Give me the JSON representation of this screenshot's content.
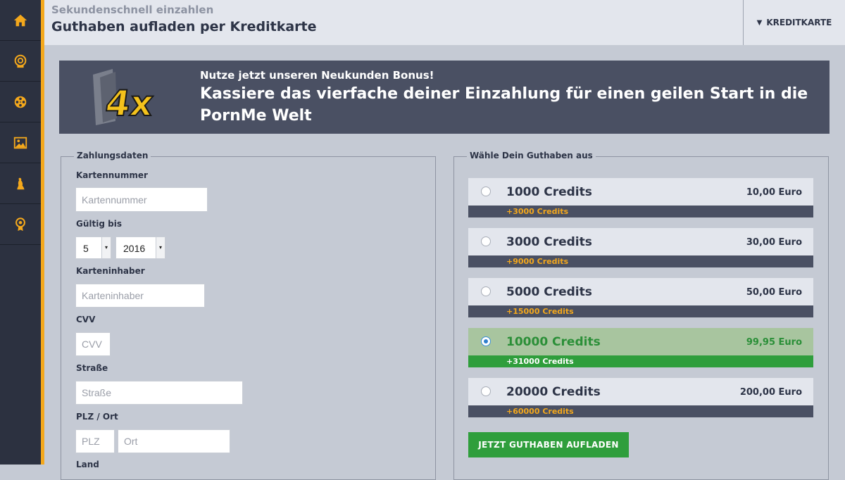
{
  "sidebar": {
    "items": [
      {
        "icon": "home-icon",
        "color": "#f4a81c"
      },
      {
        "icon": "webcam-icon",
        "color": "#f4a81c"
      },
      {
        "icon": "film-reel-icon",
        "color": "#f4a81c"
      },
      {
        "icon": "image-icon",
        "color": "#f4a81c"
      },
      {
        "icon": "figure-icon",
        "color": "#f4a81c"
      },
      {
        "icon": "award-icon",
        "color": "#f4a81c"
      }
    ]
  },
  "header": {
    "subtitle": "Sekundenschnell einzahlen",
    "title": "Guthaben aufladen per Kreditkarte",
    "payment_method": "KREDITKARTE"
  },
  "banner": {
    "badge_text": "4x",
    "subtitle": "Nutze jetzt unseren Neukunden Bonus!",
    "title": "Kassiere das vierfache deiner Einzahlung für einen geilen Start in die PornMe Welt"
  },
  "payment_form": {
    "legend": "Zahlungsdaten",
    "card_number_label": "Kartennummer",
    "card_number_placeholder": "Kartennummer",
    "valid_label": "Gültig bis",
    "month_value": "5",
    "year_value": "2016",
    "holder_label": "Karteninhaber",
    "holder_placeholder": "Karteninhaber",
    "cvv_label": "CVV",
    "cvv_placeholder": "CVV",
    "street_label": "Straße",
    "street_placeholder": "Straße",
    "zip_city_label": "PLZ / Ort",
    "zip_placeholder": "PLZ",
    "city_placeholder": "Ort",
    "country_label": "Land"
  },
  "credits": {
    "legend": "Wähle Dein Guthaben aus",
    "options": [
      {
        "name": "1000 Credits",
        "price": "10,00 Euro",
        "bonus": "+3000 Credits",
        "selected": false
      },
      {
        "name": "3000 Credits",
        "price": "30,00 Euro",
        "bonus": "+9000 Credits",
        "selected": false
      },
      {
        "name": "5000 Credits",
        "price": "50,00 Euro",
        "bonus": "+15000 Credits",
        "selected": false
      },
      {
        "name": "10000 Credits",
        "price": "99,95 Euro",
        "bonus": "+31000 Credits",
        "selected": true
      },
      {
        "name": "20000 Credits",
        "price": "200,00 Euro",
        "bonus": "+60000 Credits",
        "selected": false
      }
    ],
    "submit_label": "JETZT GUTHABEN AUFLADEN"
  },
  "colors": {
    "accent": "#f4a81c",
    "success": "#2f9e3c",
    "dark": "#4a5063",
    "sidebar": "#2c3140"
  }
}
